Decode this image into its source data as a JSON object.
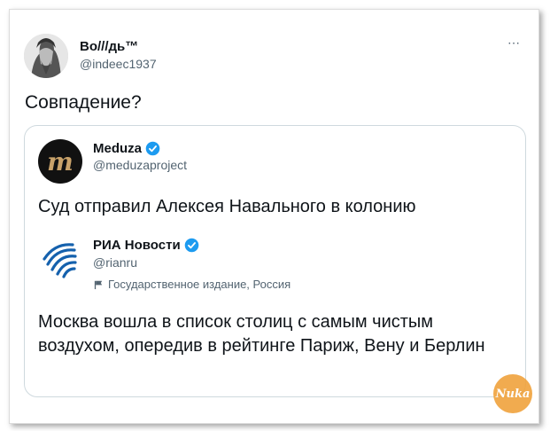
{
  "tweet": {
    "author_name": "Во///дь™",
    "author_handle": "@indeec1937",
    "more_icon": "⋯",
    "text": "Совпадение?"
  },
  "quoted": {
    "author_name": "Meduza",
    "author_handle": "@meduzaproject",
    "avatar_letter": "m",
    "text": "Суд отправил Алексея Навального в колонию"
  },
  "nested": {
    "author_name": "РИА Новости",
    "author_handle": "@rianru",
    "state_label": "Государственное издание, Россия",
    "text": "Москва вошла в список столиц с самым чистым воздухом, опередив в рейтинге Париж, Вену и Берлин"
  },
  "watermark": "Nuka",
  "colors": {
    "verified": "#1d9bf0",
    "secondary_text": "#536471",
    "ria_blue": "#1561ad",
    "meduza_gold": "#c9a26a"
  }
}
